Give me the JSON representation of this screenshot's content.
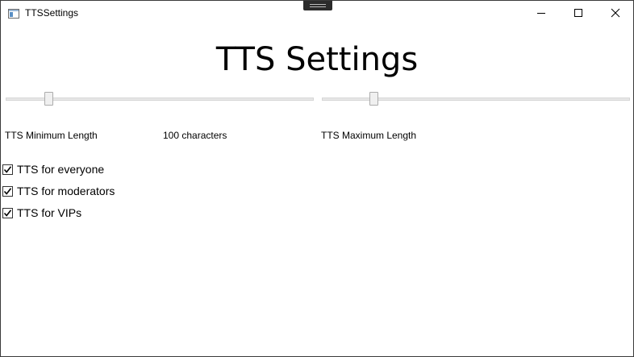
{
  "window": {
    "title": "TTSSettings"
  },
  "page": {
    "title": "TTS Settings"
  },
  "sliders": {
    "min": {
      "label": "TTS Minimum Length",
      "value_text": "100 characters",
      "level": 0.13
    },
    "max": {
      "label": "TTS Maximum Length",
      "level": 0.16
    }
  },
  "checkboxes": [
    {
      "label": "TTS for everyone",
      "checked": true
    },
    {
      "label": "TTS for moderators",
      "checked": true
    },
    {
      "label": "TTS for VIPs",
      "checked": true
    }
  ],
  "icons": {
    "app": "app-window-icon",
    "minimize": "minimize-icon",
    "maximize": "maximize-icon",
    "close": "close-icon",
    "check": "checkmark-icon"
  }
}
